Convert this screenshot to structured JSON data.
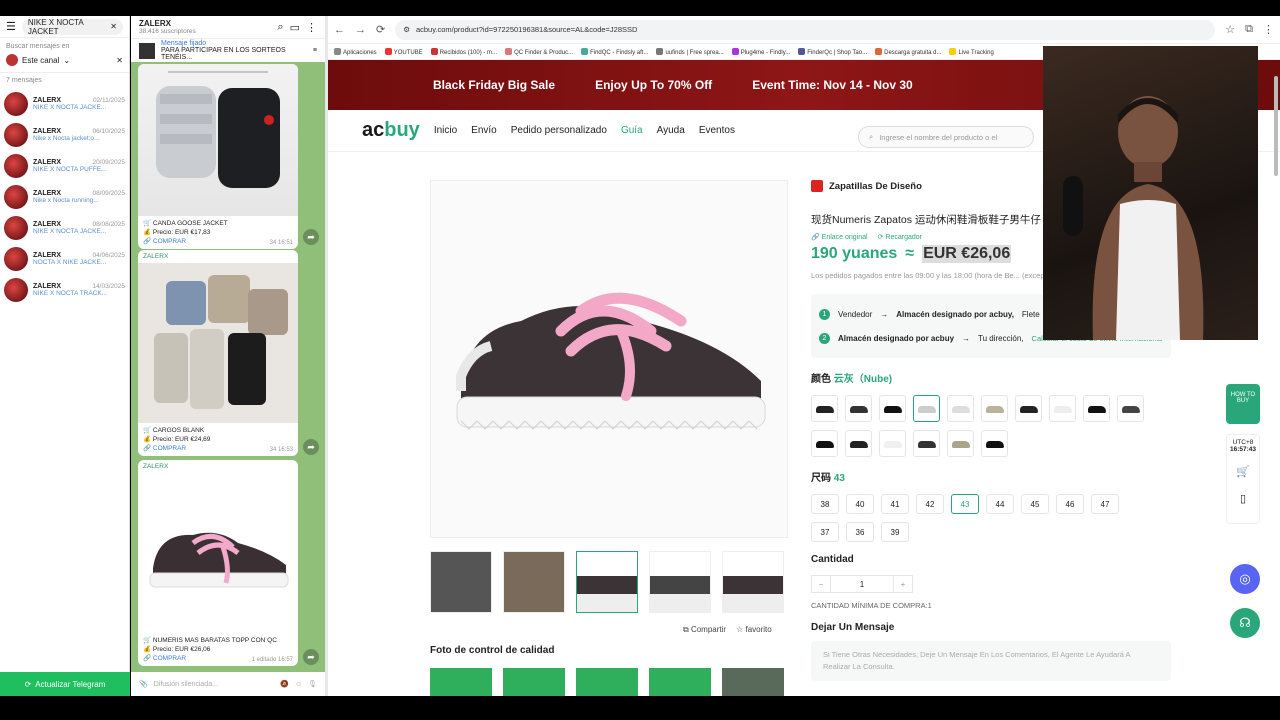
{
  "telegram": {
    "search_value": "NIKE X NOCTA JACKET",
    "search_in_label": "Buscar mensajes en",
    "channel_filter": "Este canal",
    "count_label": "7 mensajes",
    "update_button": "Actualizar Telegram",
    "results": [
      {
        "name": "ZALERX",
        "date": "02/11/2025",
        "snippet": "NIKE X NOCTA JACKE..."
      },
      {
        "name": "ZALERX",
        "date": "06/10/2025",
        "snippet": "Nike x Nocta jacket;o..."
      },
      {
        "name": "ZALERX",
        "date": "20/09/2025",
        "snippet": "NIKE X NOCTA PUFFE..."
      },
      {
        "name": "ZALERX",
        "date": "08/09/2025",
        "snippet": "Nike x Nocta running..."
      },
      {
        "name": "ZALERX",
        "date": "08/08/2025",
        "snippet": "NIKE X NOCTA JACKE..."
      },
      {
        "name": "ZALERX",
        "date": "04/06/2025",
        "snippet": "NOCTA X NIKE JACKE..."
      },
      {
        "name": "ZALERX",
        "date": "14/03/2025",
        "snippet": "NIKE X NOCTA TRACK..."
      }
    ]
  },
  "channel": {
    "name": "ZALERX",
    "subscribers": "38.416 suscriptores",
    "pinned_label": "Mensaje fijado",
    "pinned_text": "PARA PARTICIPAR EN LOS SORTEOS TENÉIS...",
    "input_placeholder": "Difusión silenciada...",
    "posts": [
      {
        "sender": "",
        "title": "CANDA GOOSE JACKET",
        "price": "Precio: EUR €17,83",
        "buy": "COMPRAR",
        "meta": "34  16:51"
      },
      {
        "sender": "ZALERX",
        "title": "CARGOS BLANK",
        "price": "Precio: EUR €24,69",
        "buy": "COMPRAR",
        "meta": "34  16:53"
      },
      {
        "sender": "ZALERX",
        "title": "NUMERIS MAS BARATAS TOPP CON QC",
        "price": "Precio: EUR €26,06",
        "buy": "COMPRAR",
        "meta": "1  editado 16:57"
      }
    ]
  },
  "browser": {
    "url": "acbuy.com/product?id=972250196381&source=AL&code=J28SSD",
    "bookmarks": [
      "Aplicaciones",
      "YOUTUBE",
      "Recibidos (100) - m...",
      "QC Finder & Produc...",
      "FindQC - Findsly aft...",
      "uufinds | Free sprea...",
      "Plug4me - Findly...",
      "FinderQc | Shop Tao...",
      "Descarga gratuita d...",
      "Live Tracking"
    ]
  },
  "banner": {
    "sale": "Black Friday Big Sale",
    "offer": "Enjoy Up To 70% Off",
    "event": "Event Time: Nov 14 - Nov 30"
  },
  "site": {
    "logo_a": "ac",
    "logo_b": "buy",
    "menu": [
      "Inicio",
      "Envío",
      "Pedido personalizado",
      "Guía",
      "Ayuda",
      "Eventos"
    ],
    "search_placeholder": "Ingrese el nombre del producto o el"
  },
  "product": {
    "shop": "Zapatillas De Diseño",
    "title": "现货Numeris Zapatos 运动休闲鞋滑板鞋子男牛仔",
    "link_original": "Enlace original",
    "link_reload": "Recargador",
    "price_cny": "190 yuanes",
    "approx": "≈",
    "price_eur": "EUR €26,06",
    "note": "Los pedidos pagados entre las 09:00 y las 18:00 (hora de Be... (excepto los domingos).",
    "route1_a": "Vendedor",
    "route1_b": "Almacén designado por acbuy,",
    "route1_c": "Flete",
    "route2_a": "Almacén designado por acbuy",
    "route2_b": "Tu dirección,",
    "route2_link": "Calcular el costo de envío internacional",
    "color_label": "颜色",
    "color_value": "云灰（Nube)",
    "size_label": "尺码",
    "size_value": "43",
    "sizes": [
      "38",
      "40",
      "41",
      "42",
      "43",
      "44",
      "45",
      "46",
      "47",
      "37",
      "36",
      "39"
    ],
    "qty_label": "Cantidad",
    "qty_value": "1",
    "min_qty": "CANTIDAD MÍNIMA DE COMPRA:1",
    "msg_label": "Dejar Un Mensaje",
    "msg_placeholder": "Si Tiene Otras Necesidades, Deje Un Mensaje En Los Comentarios, El Agente Le Ayudará A Realizar La Consulta.",
    "share": "Compartir",
    "fav": "favorito",
    "qc_label": "Foto de control de calidad"
  },
  "sidebar": {
    "tz": "UTC+8",
    "time": "16:57:43",
    "badge": "HOW TO BUY"
  },
  "colors": {
    "accent": "#2aa77a",
    "banner": "#7a1010",
    "telegram_green": "#1fbe5f"
  }
}
